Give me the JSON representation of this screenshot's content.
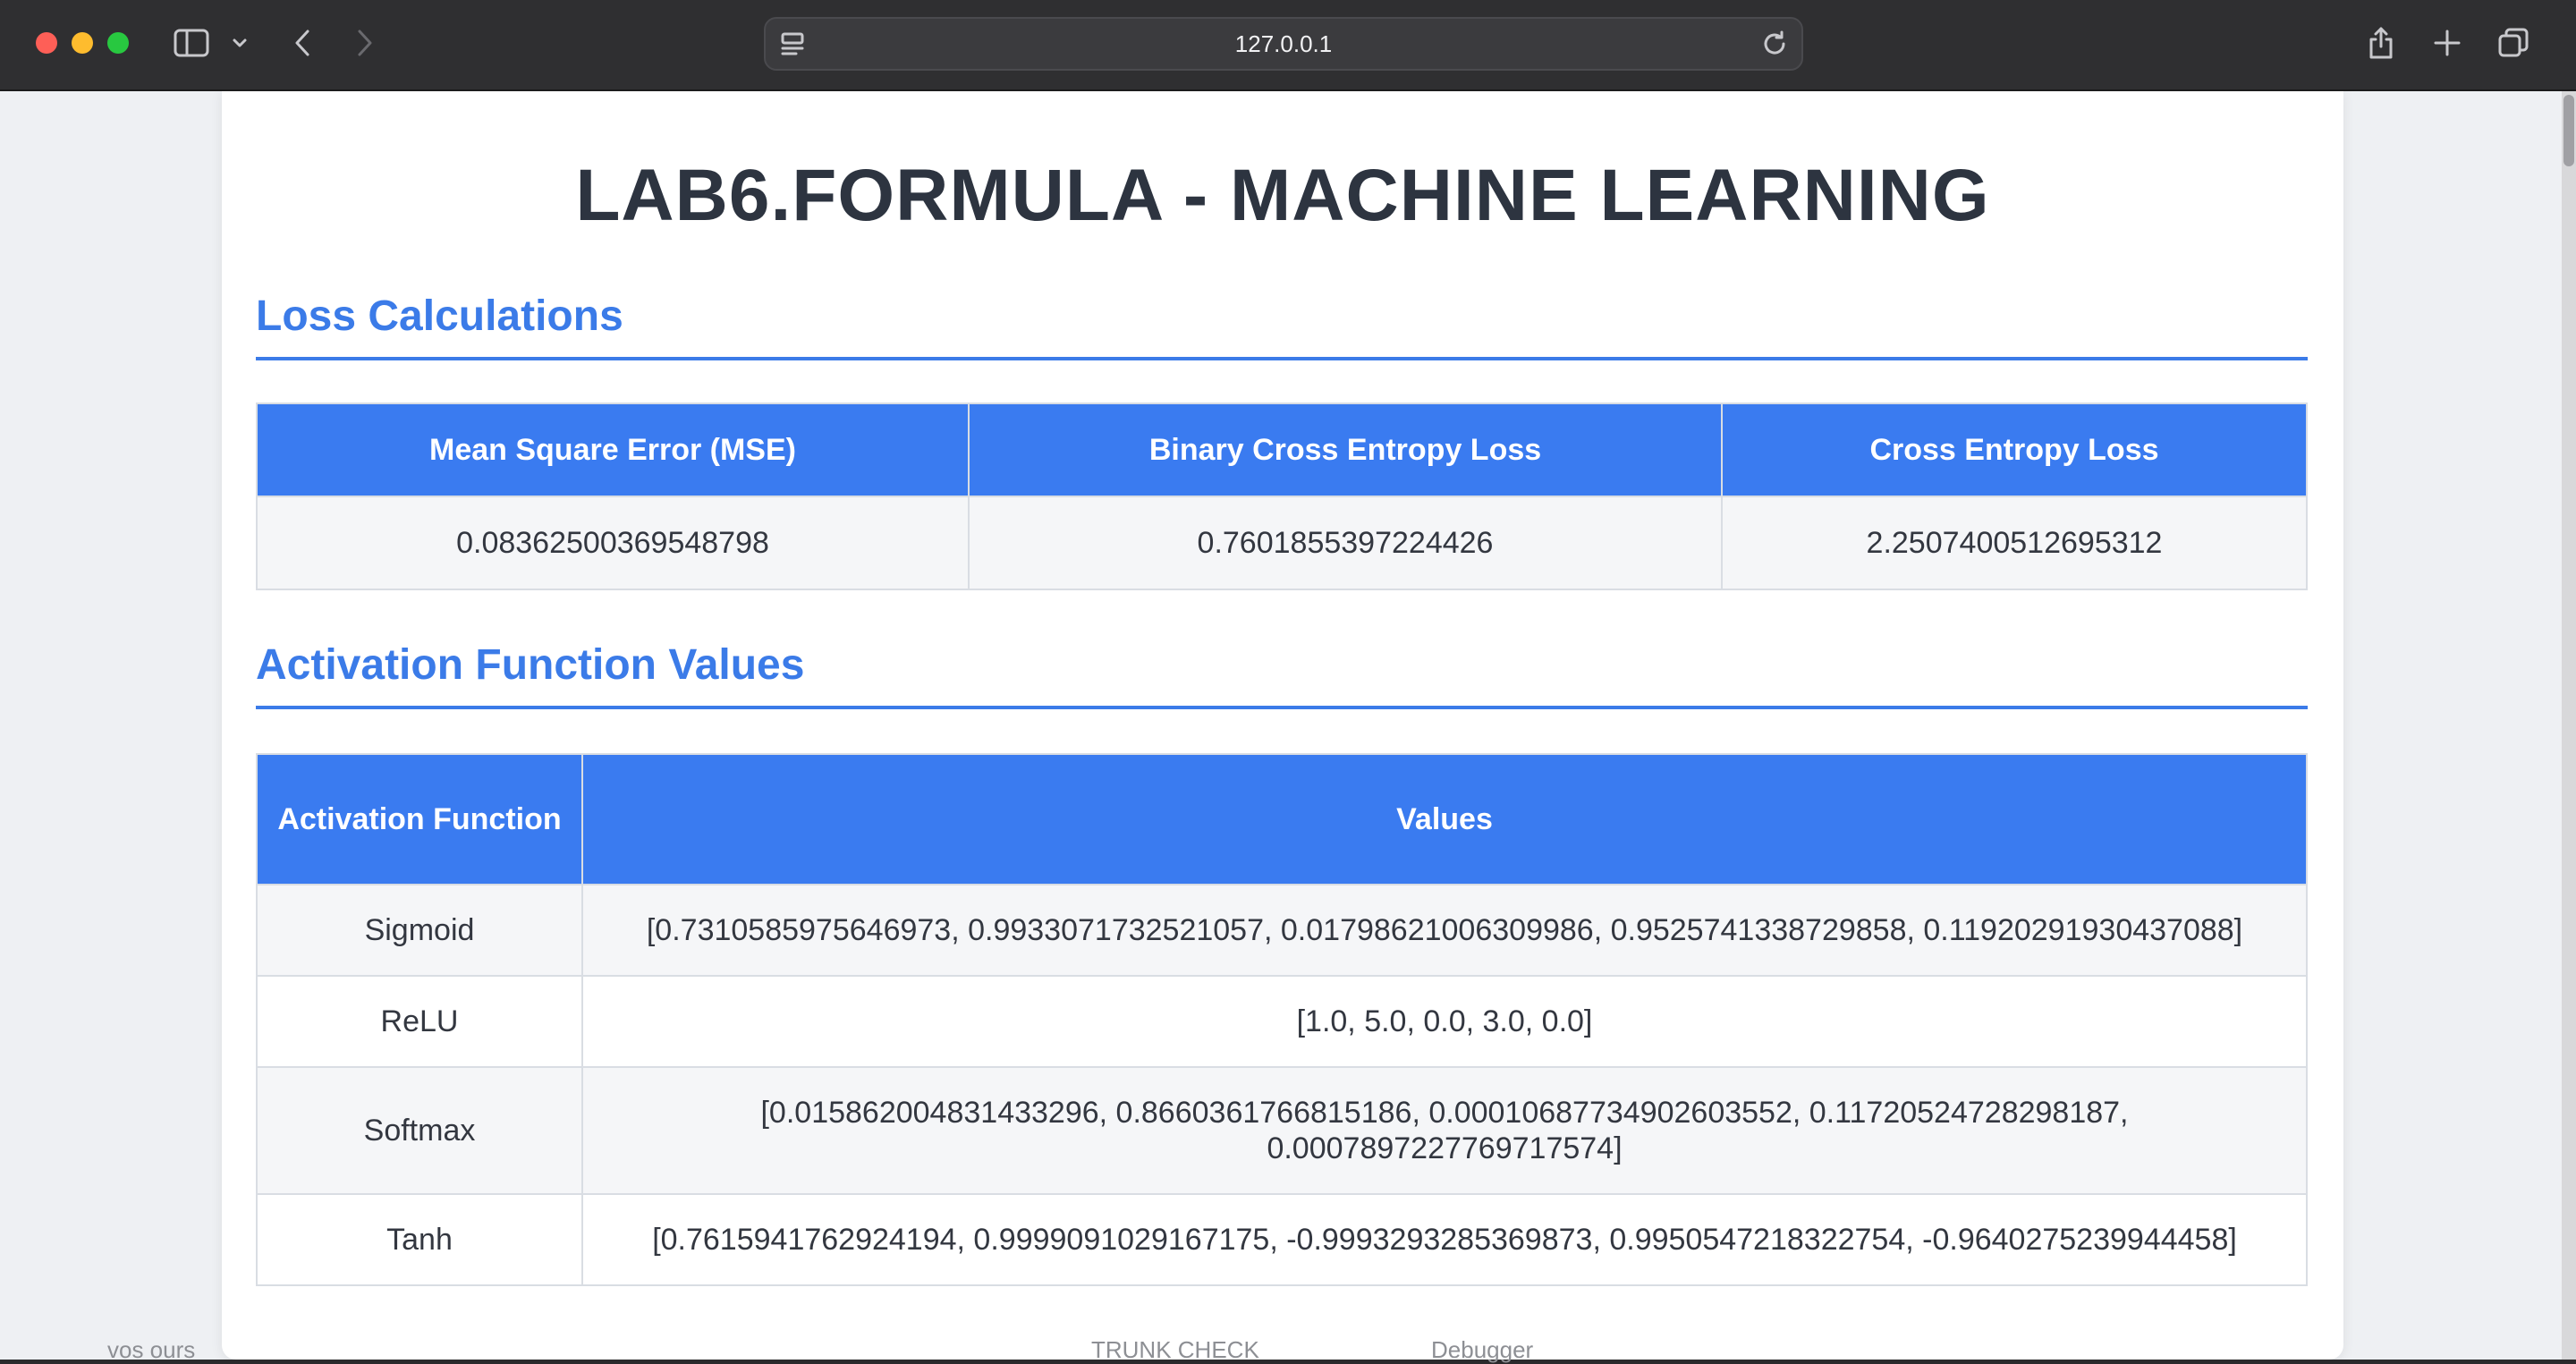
{
  "browser": {
    "url": "127.0.0.1"
  },
  "background_hint": {
    "left_text": "vos ours",
    "middle_text": "TRUNK CHECK",
    "right_text": "Debugger"
  },
  "page": {
    "title": "LAB6.FORMULA - MACHINE LEARNING"
  },
  "loss_section": {
    "heading": "Loss Calculations",
    "headers": [
      "Mean Square Error (MSE)",
      "Binary Cross Entropy Loss",
      "Cross Entropy Loss"
    ],
    "values": [
      "0.08362500369548798",
      "0.7601855397224426",
      "2.2507400512695312"
    ]
  },
  "activation_section": {
    "heading": "Activation Function Values",
    "header_function": "Activation Function",
    "header_values": "Values",
    "rows": [
      {
        "name": "Sigmoid",
        "values": "[0.7310585975646973, 0.9933071732521057, 0.01798621006309986, 0.9525741338729858, 0.11920291930437088]"
      },
      {
        "name": "ReLU",
        "values": "[1.0, 5.0, 0.0, 3.0, 0.0]"
      },
      {
        "name": "Softmax",
        "values": "[0.015862004831433296, 0.8660361766815186, 0.00010687734902603552, 0.11720524728298187, 0.0007897227769717574]"
      },
      {
        "name": "Tanh",
        "values": "[0.7615941762924194, 0.9999091029167175, -0.9993293285369873, 0.9950547218322754, -0.9640275239944458]"
      }
    ]
  }
}
